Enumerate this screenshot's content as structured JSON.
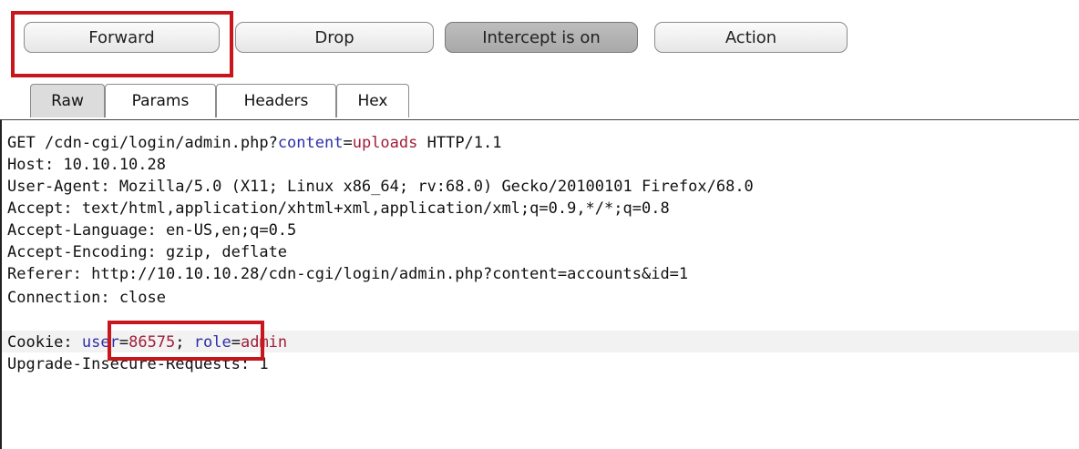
{
  "toolbar": {
    "forward_label": "Forward",
    "drop_label": "Drop",
    "intercept_label": "Intercept is on",
    "action_label": "Action"
  },
  "tabs": [
    "Raw",
    "Params",
    "Headers",
    "Hex"
  ],
  "request": {
    "line1": {
      "prefix": "GET /cdn-cgi/login/admin.php?",
      "param": "content",
      "eq": "=",
      "value": "uploads",
      "suffix": " HTTP/1.1"
    },
    "line2": "Host: 10.10.10.28",
    "line3": "User-Agent: Mozilla/5.0 (X11; Linux x86_64; rv:68.0) Gecko/20100101 Firefox/68.0",
    "line4": "Accept: text/html,application/xhtml+xml,application/xml;q=0.9,*/*;q=0.8",
    "line5": "Accept-Language: en-US,en;q=0.5",
    "line6": "Accept-Encoding: gzip, deflate",
    "line7": "Referer: http://10.10.10.28/cdn-cgi/login/admin.php?content=accounts&id=1",
    "line8": "Connection: close",
    "line9": {
      "prefix": "Cookie: ",
      "param1": "user",
      "eq1": "=",
      "value1": "86575",
      "sep": "; ",
      "param2": "role",
      "eq2": "=",
      "value2": "admin"
    },
    "line10": "Upgrade-Insecure-Requests: 1"
  },
  "colors": {
    "highlight": "#c8161d",
    "param": "#2e2ea8",
    "value": "#a01e3a"
  }
}
